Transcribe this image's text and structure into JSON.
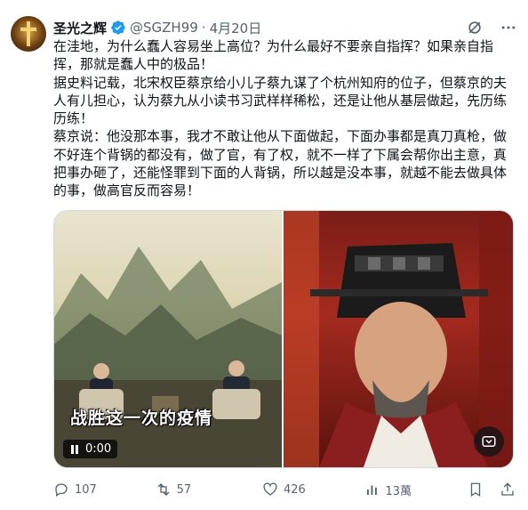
{
  "tweet": {
    "author_name": "圣光之辉",
    "handle": "@SGZH99",
    "separator": "·",
    "date": "4月20日",
    "paragraphs": [
      "在洼地，为什么蠢人容易坐上高位？为什么最好不要亲自指挥？如果亲自指挥，那就是蠢人中的极品！",
      "据史料记载，北宋权臣蔡京给小儿子蔡九谋了个杭州知府的位子，但蔡京的夫人有儿担心，认为蔡九从小读书习武样样稀松，还是让他从基层做起，先历练历练！",
      "蔡京说：他没那本事，我才不敢让他从下面做起，下面办事都是真刀真枪，做不好连个背锅的都没有，做了官，有了权，就不一样了下属会帮你出主意，真把事办砸了，还能怪罪到下面的人背锅，所以越是没本事，就越不能去做具体的事，做高官反而容易！"
    ]
  },
  "media": {
    "caption": "战胜这一次的疫情",
    "video_time": "0:00"
  },
  "actions": {
    "replies": "107",
    "reposts": "57",
    "likes": "426",
    "views": "13萬"
  },
  "colors": {
    "accent": "#1d9bf0",
    "text": "#0f1419",
    "muted": "#536471",
    "verified": "#1d9bf0"
  },
  "icons": [
    "verified-badge-icon",
    "grok-icon",
    "more-icon",
    "play-pause-icon",
    "gif-icon",
    "reply-icon",
    "repost-icon",
    "like-icon",
    "views-icon",
    "bookmark-icon",
    "share-icon"
  ]
}
